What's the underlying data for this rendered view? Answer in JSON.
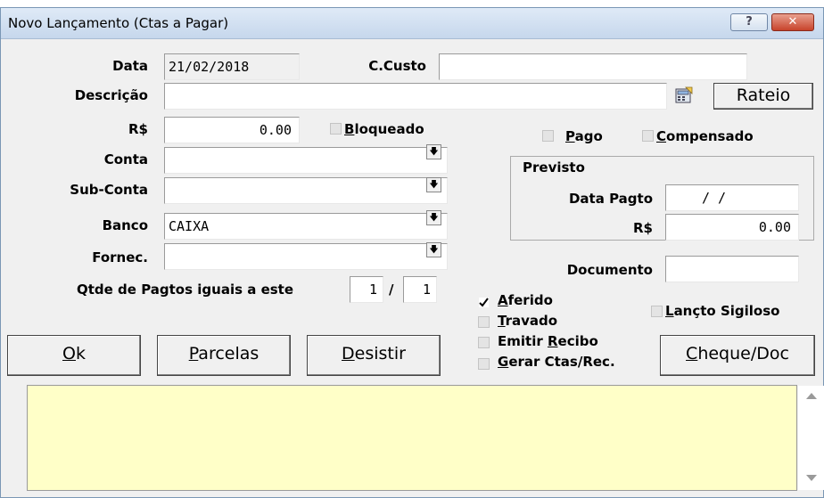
{
  "window": {
    "title": "Novo Lançamento (Ctas a Pagar)",
    "help_label": "?",
    "close_label": "✕"
  },
  "labels": {
    "data": "Data",
    "ccusto": "C.Custo",
    "descricao": "Descrição",
    "rs": "R$",
    "conta": "Conta",
    "subconta": "Sub-Conta",
    "banco": "Banco",
    "fornec": "Fornec.",
    "qtde_prefix": "Qtde de Pagtos iguais a este",
    "slash": "/",
    "previsto": "Previsto",
    "data_pagto": "Data Pagto",
    "rs2": "R$",
    "documento": "Documento"
  },
  "fields": {
    "data": "21/02/2018",
    "ccusto": "",
    "descricao": "",
    "valor": "0.00",
    "conta": "",
    "subconta": "",
    "banco": "CAIXA",
    "fornec": "",
    "qtde_a": "1",
    "qtde_b": "1",
    "data_pagto": "/ /",
    "valor_previsto": "0.00",
    "documento": ""
  },
  "checks": {
    "bloqueado": {
      "label": "Bloqueado",
      "checked": false
    },
    "pago": {
      "label": "Pago",
      "checked": false
    },
    "compensado": {
      "label": "Compensado",
      "checked": false
    },
    "aferido": {
      "label": "Aferido",
      "checked": true
    },
    "travado": {
      "label": "Travado",
      "checked": false
    },
    "emitir_recibo": {
      "label": "Emitir Recibo",
      "checked": false
    },
    "gerar_ctas": {
      "label": "Gerar Ctas/Rec.",
      "checked": false
    },
    "lancto_sigiloso": {
      "label": "Lançto Sigiloso",
      "checked": false
    }
  },
  "buttons": {
    "rateio": "Rateio",
    "ok": "Ok",
    "parcelas": "Parcelas",
    "desistir": "Desistir",
    "cheque": "Cheque/Doc"
  },
  "memo": {
    "text": ""
  },
  "icons": {
    "dropdown": "down-arrow-icon",
    "calc": "calculator-icon",
    "check": "checkmark-icon"
  }
}
